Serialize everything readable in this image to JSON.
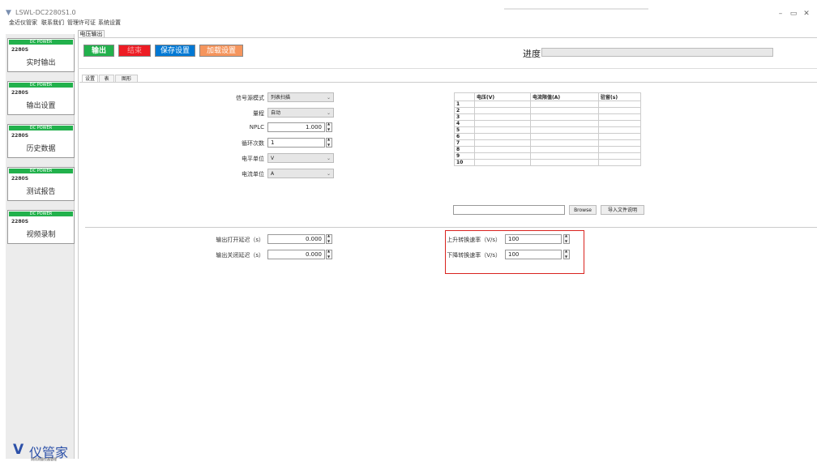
{
  "app": {
    "title": "LSWL-DC2280S1.0"
  },
  "menu": [
    "金近仪管家",
    "联系我们",
    "管理许可证",
    "系统设置"
  ],
  "window_controls": {
    "minimize": "–",
    "restore": "▭",
    "close": "✕"
  },
  "sidebar": {
    "cards": [
      {
        "header": "DC POWER",
        "model": "2280S",
        "label": "实时输出"
      },
      {
        "header": "DC POWER",
        "model": "2280S",
        "label": "输出设置"
      },
      {
        "header": "DC POWER",
        "model": "2280S",
        "label": "历史数据"
      },
      {
        "header": "DC POWER",
        "model": "2280S",
        "label": "测试报告"
      },
      {
        "header": "DC POWER",
        "model": "2280S",
        "label": "视频录制"
      }
    ],
    "brand": {
      "text": "仪管家",
      "subtext": "测试测量仪器管理",
      "icon": "V"
    }
  },
  "main_tab": "电压输出",
  "toolbar": {
    "output": "输出",
    "end": "结束",
    "save": "保存设置",
    "load": "加载设置",
    "colors": {
      "output": "#22b14c",
      "end": "#ed1c24",
      "save": "#0078d4",
      "load": "#f5955d"
    }
  },
  "progress": {
    "label": "进度",
    "value": 0
  },
  "subtabs": [
    "设置",
    "表",
    "图形"
  ],
  "form": {
    "signal_mode": {
      "label": "信号源模式",
      "value": "列表扫描"
    },
    "range": {
      "label": "量程",
      "value": "自动"
    },
    "nplc": {
      "label": "NPLC",
      "value": "1.000"
    },
    "cycles": {
      "label": "循环次数",
      "value": "1"
    },
    "voltage_unit": {
      "label": "电平单位",
      "value": "V"
    },
    "current_unit": {
      "label": "电流单位",
      "value": "A"
    },
    "on_delay": {
      "label": "输出打开延迟（s）",
      "value": "0.000"
    },
    "off_delay": {
      "label": "输出关闭延迟（s）",
      "value": "0.000"
    },
    "rise_rate": {
      "label": "上升转换速率（V/s）",
      "value": "100"
    },
    "fall_rate": {
      "label": "下降转换速率（V/s）",
      "value": "100"
    }
  },
  "table": {
    "headers": [
      "",
      "电压(V)",
      "电流限值(A)",
      "驻留(s)"
    ],
    "rows": [
      "1",
      "2",
      "3",
      "4",
      "5",
      "6",
      "7",
      "8",
      "9",
      "10"
    ]
  },
  "file": {
    "browse": "Browse",
    "import_help": "导入文件说明",
    "path": ""
  }
}
